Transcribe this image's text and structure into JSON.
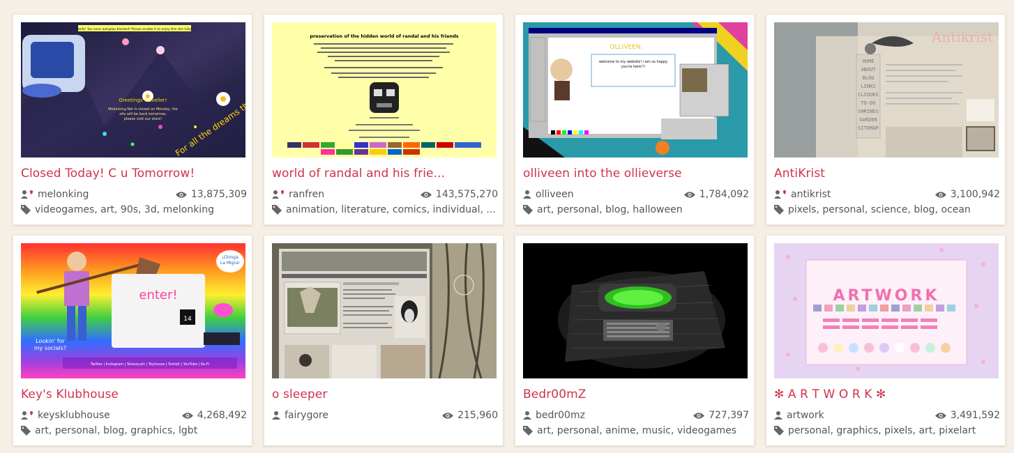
{
  "cards": [
    {
      "title": "Closed Today! C u Tomorrow!",
      "user": "melonking",
      "user_icon": "user-heart-icon",
      "views": "13,875,309",
      "tags": [
        "videogames",
        "art",
        "90s",
        "3d",
        "melonking"
      ]
    },
    {
      "title": "world of randal and his frie...",
      "user": "ranfren",
      "user_icon": "user-heart-icon",
      "views": "143,575,270",
      "tags": [
        "animation",
        "literature",
        "comics",
        "individual",
        "..."
      ]
    },
    {
      "title": "olliveen into the ollieverse",
      "user": "olliveen",
      "user_icon": "user-icon",
      "views": "1,784,092",
      "tags": [
        "art",
        "personal",
        "blog",
        "halloween"
      ]
    },
    {
      "title": "AntiKrist",
      "user": "antikrist",
      "user_icon": "user-heart-icon",
      "views": "3,100,942",
      "tags": [
        "pixels",
        "personal",
        "science",
        "blog",
        "ocean"
      ]
    },
    {
      "title": "Key's Klubhouse",
      "user": "keysklubhouse",
      "user_icon": "user-heart-icon",
      "views": "4,268,492",
      "tags": [
        "art",
        "personal",
        "blog",
        "graphics",
        "lgbt"
      ]
    },
    {
      "title": "o sleeper",
      "user": "fairygore",
      "user_icon": "user-icon",
      "views": "215,960",
      "tags": []
    },
    {
      "title": "Bedr00mZ",
      "user": "bedr00mz",
      "user_icon": "user-icon",
      "views": "727,397",
      "tags": [
        "art",
        "personal",
        "anime",
        "music",
        "videogames"
      ]
    },
    {
      "title": "✻ A R T W O R K ✻",
      "user": "artwork",
      "user_icon": "user-icon",
      "views": "3,491,592",
      "tags": [
        "personal",
        "graphics",
        "pixels",
        "art",
        "pixelart"
      ]
    }
  ],
  "thumb_text": {
    "c1_banner": "Hello! You have autoplay blocked! Please enable it to enjoy this site fully!",
    "c1_greet": "Greetings Traveller!",
    "c1_msg": "Melonking.Net is closed on Monday, the site will be back tomorrow, please visit our store!",
    "c1_curve": "For all the dreams that",
    "c2_title": "preservation of the hidden world of randal and his friends",
    "c3_logo": "OLLIVEEN.",
    "c3_welcome": "welcome to my website! i am so happy you're here!!!",
    "c4_logo": "Antikrist",
    "c4_nav": [
      "HOME",
      "ABOUT",
      "BLOG",
      "LINKS",
      "CLIQUES",
      "TO-DO",
      "SHRINES",
      "GARDEN",
      "SITEMAP"
    ],
    "c5_bubble": "¡Chinga La Migra!",
    "c5_enter": "enter!",
    "c5_socials": "Lookin' for my socials?",
    "c5_num": "14",
    "c8_logo": "ARTWORK"
  },
  "colors": {
    "accent": "#d0334a",
    "background": "#f5efe6",
    "card": "#ffffff",
    "text": "#555555"
  }
}
